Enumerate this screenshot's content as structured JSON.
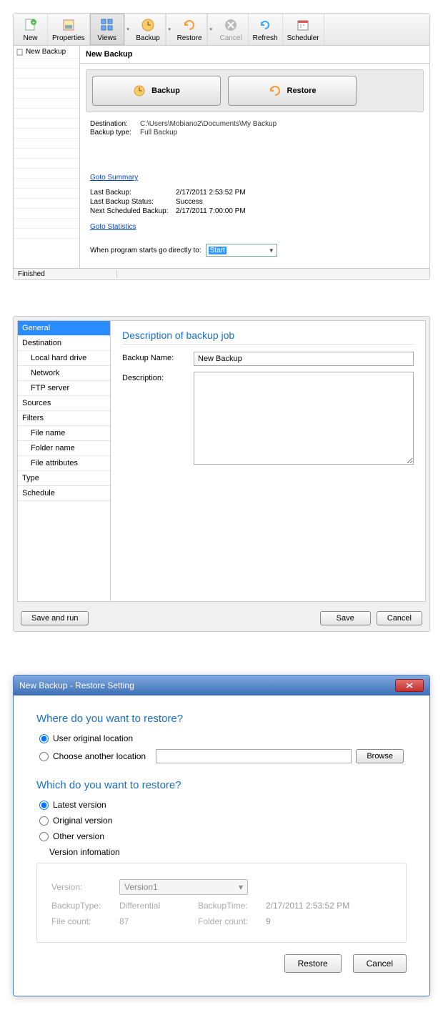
{
  "toolbar": {
    "new_label": "New",
    "properties_label": "Properties",
    "views_label": "Views",
    "backup_label": "Backup",
    "restore_label": "Restore",
    "cancel_label": "Cancel",
    "refresh_label": "Refresh",
    "scheduler_label": "Scheduler"
  },
  "tree": {
    "item0": "New Backup"
  },
  "pane": {
    "title": "New Backup",
    "backup_btn": "Backup",
    "restore_btn": "Restore"
  },
  "info": {
    "dest_label": "Destination:",
    "dest_val": "C:\\Users\\Mobiano2\\Documents\\My Backup",
    "type_label": "Backup type:",
    "type_val": "Full Backup"
  },
  "summary": {
    "goto_summary": "Goto Summary",
    "last_backup_label": "Last Backup:",
    "last_backup_val": "2/17/2011 2:53:52 PM",
    "status_label": "Last Backup Status:",
    "status_val": "Success",
    "next_label": "Next Scheduled Backup:",
    "next_val": "2/17/2011 7:00:00 PM",
    "goto_stats": "Goto Statistics"
  },
  "goto": {
    "label": "When program starts go directly to:",
    "value": "Start"
  },
  "status": {
    "text": "Finished"
  },
  "config": {
    "nav": {
      "general": "General",
      "destination": "Destination",
      "local": "Local hard drive",
      "network": "Network",
      "ftp": "FTP server",
      "sources": "Sources",
      "filters": "Filters",
      "filename": "File name",
      "foldername": "Folder name",
      "fileattr": "File attributes",
      "type": "Type",
      "schedule": "Schedule"
    },
    "title": "Description of backup job",
    "name_label": "Backup Name:",
    "name_val": "New Backup",
    "desc_label": "Description:",
    "save_run": "Save and run",
    "save": "Save",
    "cancel": "Cancel"
  },
  "restore": {
    "title": "New Backup - Restore Setting",
    "where_title": "Where do you want to restore?",
    "opt_original": "User original location",
    "opt_another": "Choose another location",
    "browse": "Browse",
    "which_title": "Which do you want to restore?",
    "opt_latest": "Latest version",
    "opt_origver": "Original version",
    "opt_other": "Other version",
    "version_info": "Version infomation",
    "version_label": "Version:",
    "version_val": "Version1",
    "btype_label": "BackupType:",
    "btype_val": "Differential",
    "btime_label": "BackupTime:",
    "btime_val": "2/17/2011 2:53:52 PM",
    "fcount_label": "File count:",
    "fcount_val": "87",
    "foldcount_label": "Folder count:",
    "foldcount_val": "9",
    "restore_btn": "Restore",
    "cancel_btn": "Cancel"
  }
}
